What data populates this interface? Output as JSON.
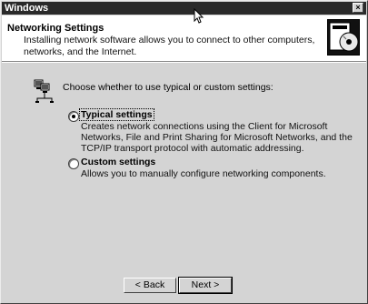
{
  "window": {
    "title": "Windows",
    "close_glyph": "×"
  },
  "header": {
    "title": "Networking Settings",
    "description": "Installing network software allows you to connect to other computers, networks, and the Internet.",
    "icon": "network-setup-icon"
  },
  "body": {
    "icon": "network-computers-icon",
    "prompt": "Choose whether to use typical or custom settings:",
    "options": [
      {
        "label": "Typical settings",
        "description": "Creates network connections using the Client for Microsoft Networks, File and Print Sharing for Microsoft Networks, and the TCP/IP transport protocol with automatic addressing.",
        "selected": true
      },
      {
        "label": "Custom settings",
        "description": "Allows you to manually configure networking components.",
        "selected": false
      }
    ]
  },
  "buttons": {
    "back": "< Back",
    "next": "Next >"
  }
}
